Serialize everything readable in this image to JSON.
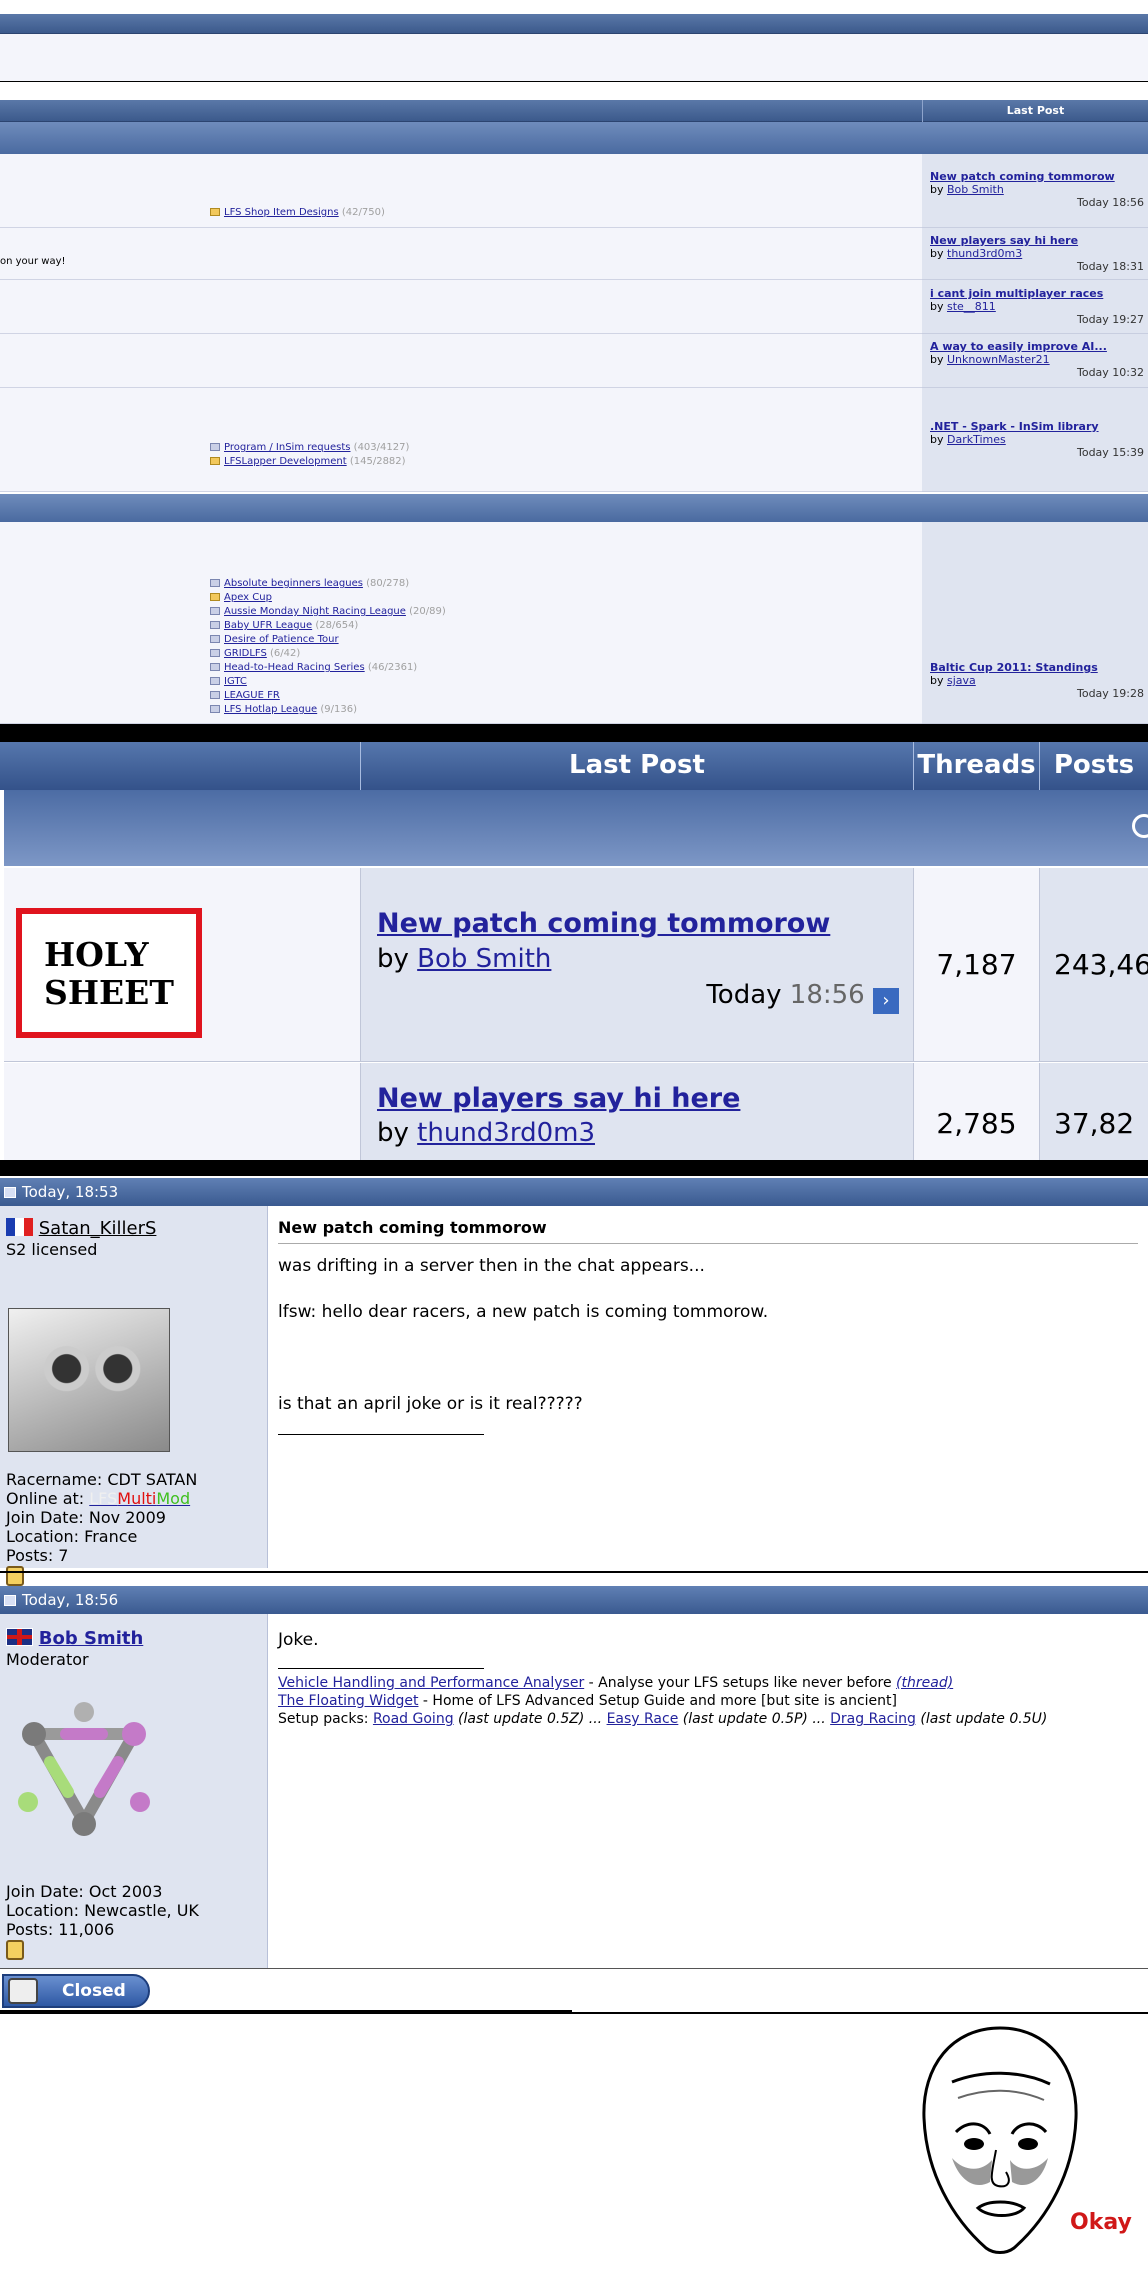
{
  "forum": {
    "last_post_header": "Last Post",
    "rows": [
      {
        "subforums": [
          {
            "name": "LFS Shop Item Designs",
            "count": "(42/750)"
          }
        ],
        "lp_title": "New patch coming tommorow",
        "lp_by": "by",
        "lp_user": "Bob Smith",
        "lp_time": "Today 18:56"
      },
      {
        "desc_fragment": "on your way!",
        "lp_title": "New players say hi here",
        "lp_by": "by",
        "lp_user": "thund3rd0m3",
        "lp_time": "Today 18:31"
      },
      {
        "lp_title": "i cant join multiplayer races",
        "lp_by": "by",
        "lp_user": "ste__811",
        "lp_time": "Today 19:27"
      },
      {
        "lp_title": "A way to easily improve AI...",
        "lp_by": "by",
        "lp_user": "UnknownMaster21",
        "lp_time": "Today 10:32"
      },
      {
        "subforums": [
          {
            "name": "Program / InSim requests",
            "count": "(403/4127)"
          },
          {
            "name": "LFSLapper Development",
            "count": "(145/2882)"
          }
        ],
        "lp_title": ".NET - Spark - InSim library",
        "lp_by": "by",
        "lp_user": "DarkTimes",
        "lp_time": "Today 15:39"
      }
    ],
    "leagues": {
      "subforums": [
        {
          "name": "Absolute beginners leagues",
          "count": "(80/278)"
        },
        {
          "name": "Apex Cup",
          "count": ""
        },
        {
          "name": "Aussie Monday Night Racing League",
          "count": "(20/89)"
        },
        {
          "name": "Baby UFR League",
          "count": "(28/654)"
        },
        {
          "name": "Desire of Patience Tour",
          "count": ""
        },
        {
          "name": "GRIDLFS",
          "count": "(6/42)"
        },
        {
          "name": "Head-to-Head Racing Series",
          "count": "(46/2361)"
        },
        {
          "name": "IGTC",
          "count": ""
        },
        {
          "name": "LEAGUE FR",
          "count": ""
        },
        {
          "name": "LFS Hotlap League",
          "count": "(9/136)"
        }
      ],
      "lp_title": "Baltic Cup 2011: Standings",
      "lp_by": "by",
      "lp_user": "sjava",
      "lp_time": "Today 19:28"
    }
  },
  "zoom": {
    "headers": {
      "last_post": "Last Post",
      "threads": "Threads",
      "posts": "Posts"
    },
    "holy_sheet": "HOLY\nSHEET",
    "row1": {
      "title": "New patch coming tommorow",
      "by": "by",
      "user": "Bob Smith",
      "time_word": "Today",
      "time": "18:56",
      "threads": "7,187",
      "posts": "243,46"
    },
    "row2": {
      "title": "New players say hi here",
      "by": "by",
      "user": "thund3rd0m3",
      "threads": "2,785",
      "posts": "37,82"
    }
  },
  "thread": {
    "post1": {
      "date": "Today, 18:53",
      "username": "Satan_KillerS",
      "user_title": "S2 licensed",
      "racername": "Racername: CDT SATAN",
      "online_label": "Online at:",
      "online_value_1": "LFS",
      "online_value_2": "Multi",
      "online_value_3": "Mod",
      "join_date": "Join Date: Nov 2009",
      "location": "Location: France",
      "posts": "Posts: 7",
      "title": "New patch coming tommorow",
      "line1": "was drifting in a server then in the chat appears...",
      "line2": "lfsw: hello dear racers, a new patch is coming tommorow.",
      "line3": "is that an april joke or is it real?????"
    },
    "post2": {
      "date": "Today, 18:56",
      "username": "Bob Smith",
      "user_title": "Moderator",
      "join_date": "Join Date: Oct 2003",
      "location": "Location: Newcastle, UK",
      "posts": "Posts: 11,006",
      "body": "Joke.",
      "sig1_link": "Vehicle Handling and Performance Analyser",
      "sig1_text": " - Analyse your LFS setups like never before ",
      "sig1_thread": "(thread)",
      "sig2_link": "The Floating Widget",
      "sig2_text": " - Home of LFS Advanced Setup Guide and more [but site is ancient]",
      "sig3_label": "Setup packs: ",
      "sig3_a": "Road Going",
      "sig3_a_note": " (last update 0.5Z) ... ",
      "sig3_b": "Easy Race",
      "sig3_b_note": " (last update 0.5P) ... ",
      "sig3_c": "Drag Racing",
      "sig3_c_note": " (last update 0.5U)"
    },
    "closed_button": "Closed"
  },
  "meme": {
    "caption": "Okay"
  },
  "colors": {
    "header_blue": "#3c5a8c",
    "link": "#22229c",
    "holy_red": "#e0141e",
    "okay_red": "#d01818"
  }
}
